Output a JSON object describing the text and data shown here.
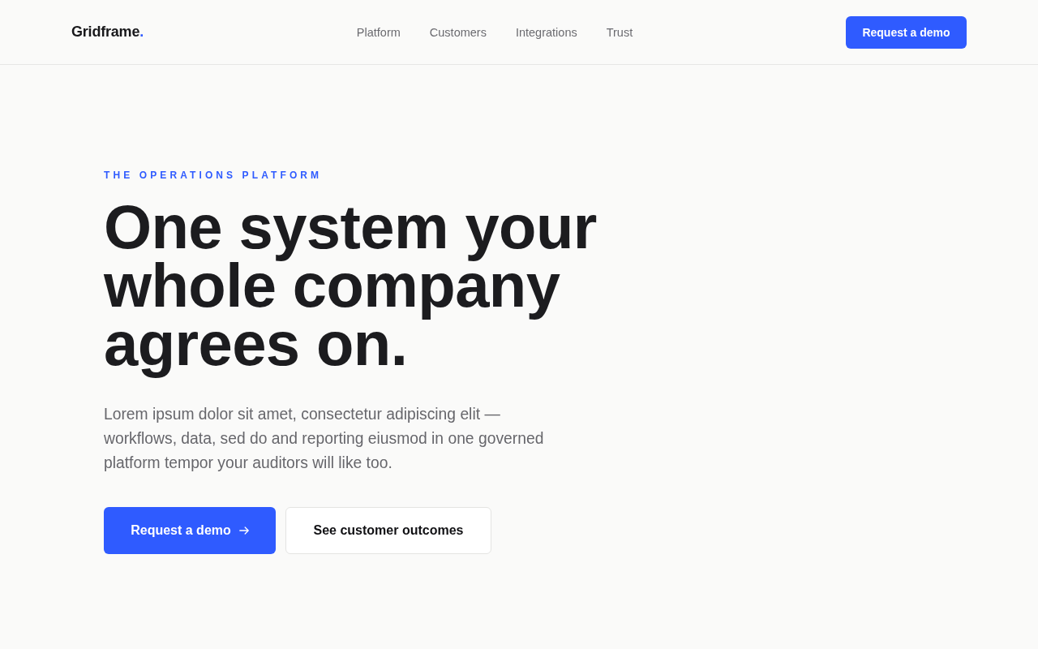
{
  "header": {
    "logo": {
      "name": "Gridframe",
      "mark": "."
    },
    "nav": [
      "Platform",
      "Customers",
      "Integrations",
      "Trust"
    ],
    "cta": "Request a demo"
  },
  "hero": {
    "eyebrow": "THE OPERATIONS PLATFORM",
    "headline": "One system your whole company agrees on.",
    "body": "Lorem ipsum dolor sit amet, consectetur adipiscing elit — workflows, data, sed do and reporting eiusmod in one governed platform tempor your auditors will like too.",
    "actions": [
      {
        "label": "Request a demo",
        "kind": "primary"
      },
      {
        "label": "See customer outcomes",
        "kind": "secondary"
      }
    ]
  }
}
